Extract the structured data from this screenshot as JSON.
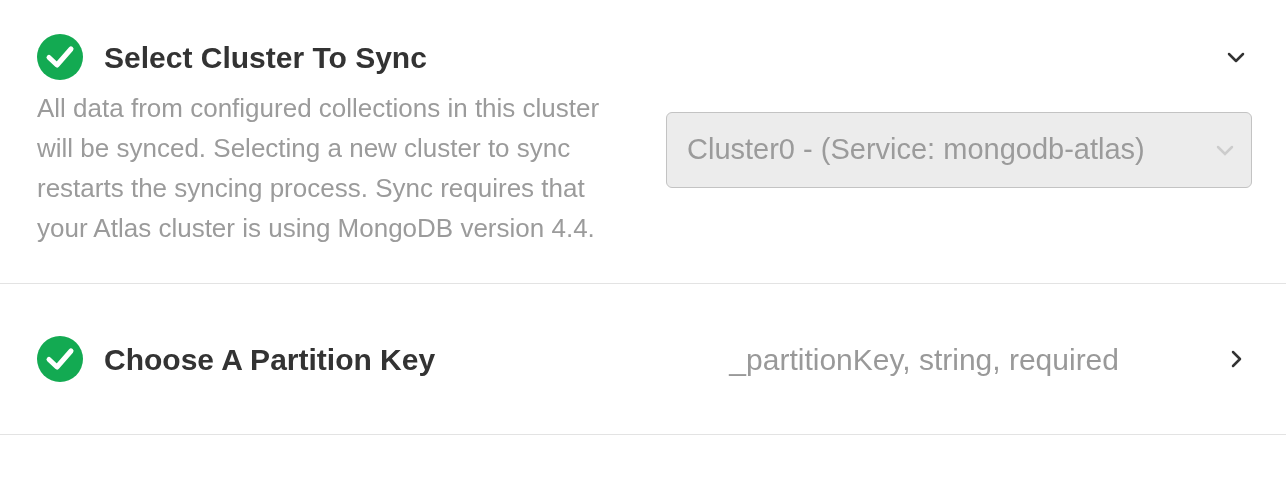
{
  "sections": [
    {
      "title": "Select Cluster To Sync",
      "completed": true,
      "expanded": true,
      "description": "All data from configured collections in this cluster will be synced. Selecting a new cluster to sync restarts the syncing process. Sync requires that your Atlas cluster is using MongoDB version 4.4.",
      "select": {
        "value": "Cluster0 - (Service: mongodb-atlas)",
        "disabled": true
      }
    },
    {
      "title": "Choose A Partition Key",
      "completed": true,
      "expanded": false,
      "summary": "_partitionKey, string, required"
    }
  ]
}
